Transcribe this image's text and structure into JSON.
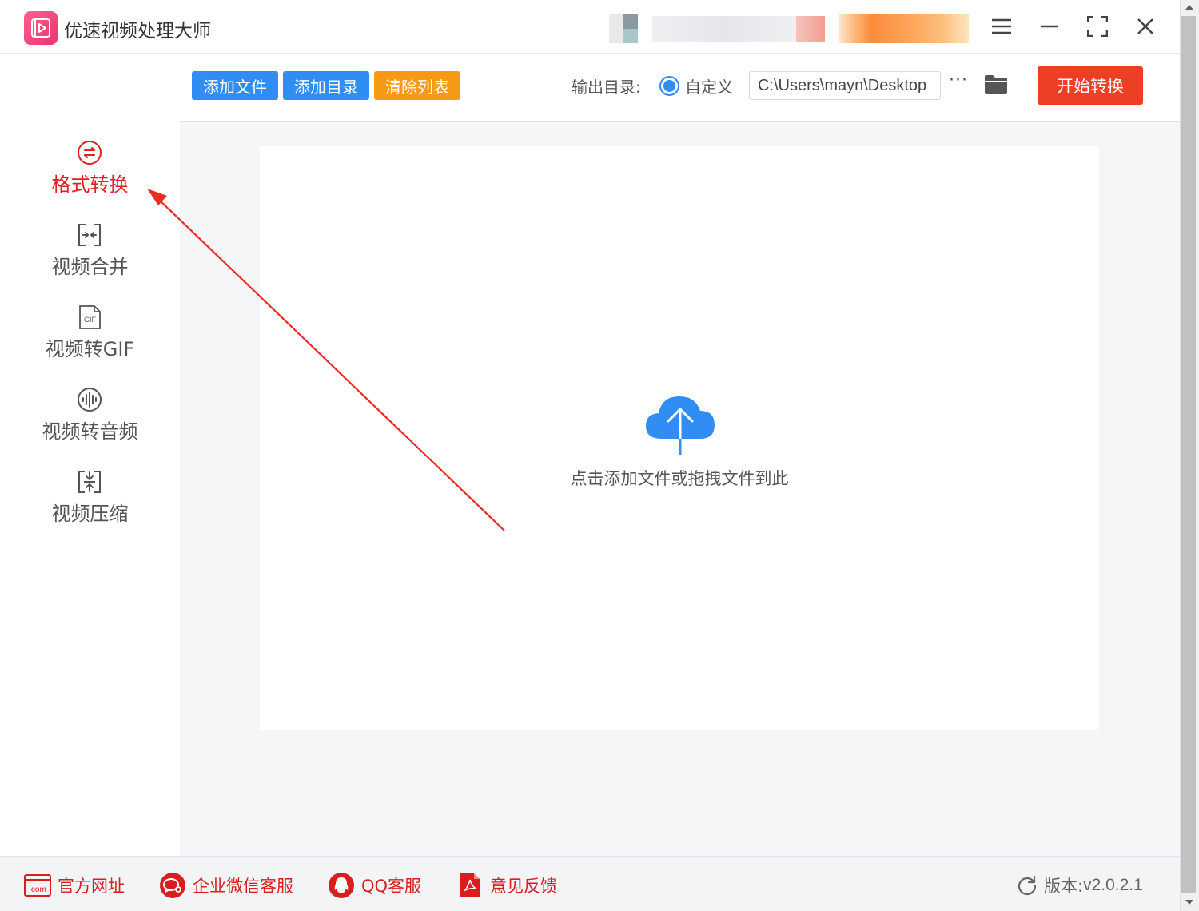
{
  "app": {
    "title": "优速视频处理大师"
  },
  "window_controls": {
    "menu_icon": "hamburger-menu-icon",
    "minimize_icon": "minimize-icon",
    "maximize_icon": "maximize-icon",
    "close_icon": "close-icon"
  },
  "sidebar": {
    "items": [
      {
        "label": "格式转换",
        "icon": "convert-icon",
        "active": true
      },
      {
        "label": "视频合并",
        "icon": "merge-icon",
        "active": false
      },
      {
        "label": "视频转GIF",
        "icon": "gif-icon",
        "active": false
      },
      {
        "label": "视频转音频",
        "icon": "audio-icon",
        "active": false
      },
      {
        "label": "视频压缩",
        "icon": "compress-icon",
        "active": false
      }
    ]
  },
  "toolbar": {
    "add_file": "添加文件",
    "add_folder": "添加目录",
    "clear_list": "清除列表",
    "output_label": "输出目录:",
    "custom_label": "自定义",
    "output_path": "C:\\Users\\mayn\\Desktop",
    "more": "···",
    "start": "开始转换"
  },
  "dropzone": {
    "text": "点击添加文件或拖拽文件到此"
  },
  "footer": {
    "website": "官方网址",
    "website_icon_text": ".com",
    "wechat": "企业微信客服",
    "qq": "QQ客服",
    "feedback": "意见反馈",
    "version_label": "版本:",
    "version": "v2.0.2.1"
  },
  "colors": {
    "accent_blue": "#2f8df4",
    "accent_orange": "#f59a12",
    "start_red": "#ec3f25",
    "active_red": "#e02020",
    "brand_pink": "#e8366e"
  }
}
